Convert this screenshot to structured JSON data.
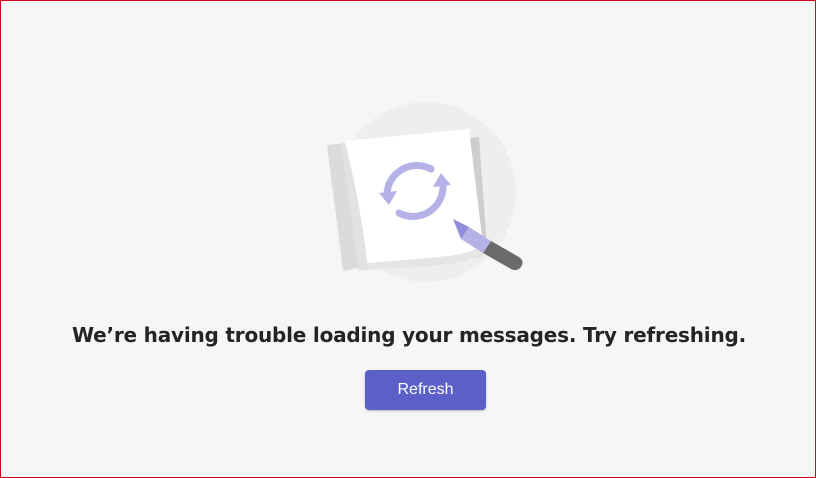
{
  "empty_state": {
    "illustration_icon": "refresh-note-icon",
    "message": "We’re having trouble loading your messages. Try refreshing.",
    "refresh_label": "Refresh"
  },
  "colors": {
    "accent": "#5b5fc7",
    "background": "#f6f6f6",
    "message_text": "#242424",
    "illustration_sync": "#b4b2e6",
    "frame_border": "#d0021b"
  }
}
